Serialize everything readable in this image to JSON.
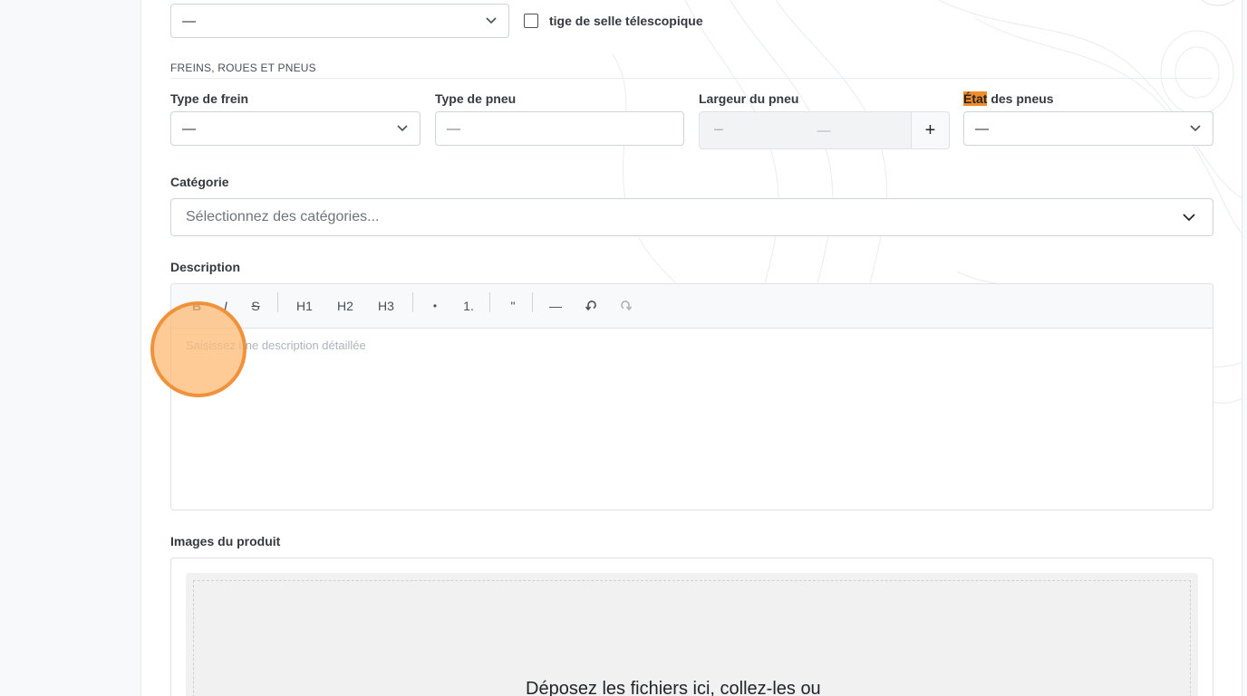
{
  "top_row": {
    "select_value": "—",
    "checkbox_label": "tige de selle télescopique"
  },
  "section": {
    "title": "FREINS, ROUES ET PNEUS"
  },
  "fields": {
    "brake_type": {
      "label": "Type de frein",
      "value": "—"
    },
    "tire_type": {
      "label": "Type de pneu",
      "placeholder": "—"
    },
    "tire_width": {
      "label": "Largeur du pneu",
      "value": "—",
      "minus": "−",
      "plus": "+"
    },
    "tire_condition": {
      "label_highlight": "État",
      "label_rest": " des pneus",
      "value": "—"
    }
  },
  "category": {
    "label": "Catégorie",
    "placeholder": "Sélectionnez des catégories..."
  },
  "description": {
    "label": "Description",
    "placeholder": "Saisissez une description détaillée",
    "toolbar": {
      "bold": "B",
      "italic": "I",
      "strike": "S",
      "h1": "H1",
      "h2": "H2",
      "h3": "H3",
      "bullet": "•",
      "ordered": "1.",
      "quote": "\"",
      "rule": "—"
    }
  },
  "images": {
    "label": "Images du produit",
    "dropzone_text": "Déposez les fichiers ici, collez-les ou"
  },
  "colors": {
    "highlight": "#f28c28",
    "cursor": "#f0923b"
  }
}
